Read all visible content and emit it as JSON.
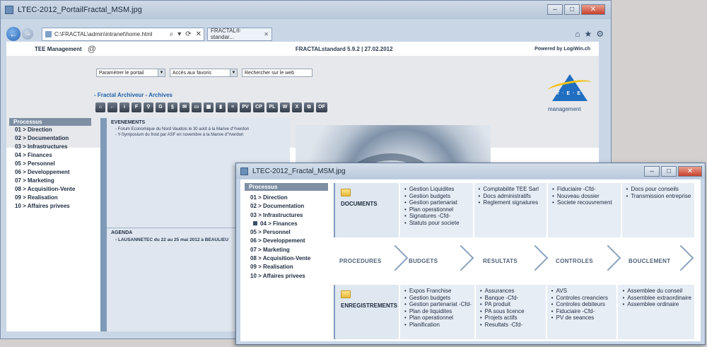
{
  "back_window": {
    "title": "LTEC-2012_PortailFractal_MSM.jpg",
    "controls": [
      "–",
      "□",
      "✕"
    ],
    "browser": {
      "url": "C:\\FRACTAL\\admin\\intranet\\home.html",
      "url_icons": [
        "⌕",
        "▾",
        "⟳",
        "✕"
      ],
      "tab_label": "FRACTAL® standar...",
      "tab_close": "✕",
      "toolbar_icons": [
        "⌂",
        "★",
        "⚙"
      ]
    },
    "header": {
      "brand": "TEE Management",
      "at_icon": "@",
      "version": "FRACTALstandard 5.9.2 | 27.02.2012",
      "powered_by": "Powered by LogiWin.ch"
    },
    "selects": [
      {
        "label": "Paramétrer le portail"
      },
      {
        "label": "Accès aux favoris"
      },
      {
        "label": "Rechercher sur le web"
      }
    ],
    "breadcrumb": "- Fractal Archiveur - Archives",
    "toolbar": [
      "⌂",
      "←",
      "i",
      "F",
      "⚲",
      "G",
      "§",
      "✉",
      "▭",
      "▦",
      "▮",
      "≡",
      "PV",
      "CP",
      "PL",
      "W",
      "X",
      "⧉",
      "OF"
    ],
    "logo": {
      "tee": "T · E · E",
      "text": "management"
    },
    "sidebar": {
      "heading": "Processus",
      "items": [
        "01 > Direction",
        "02 > Documentation",
        "03 > Infrastructures",
        "04 > Finances",
        "05 > Personnel",
        "06 > Developpement",
        "07 > Marketing",
        "08 > Acquisition-Vente",
        "09 > Realisation",
        "10 > Affaires privees"
      ]
    },
    "events": {
      "heading": "EVENEMENTS",
      "items": [
        "- Forum Economique du Nord Vaudois le 30 août à la Marive d'Yverdon",
        "- Y-Symposium du froid par ASF en novembre à la Marive d'Yverdon"
      ]
    },
    "agenda": {
      "heading": "AGENDA",
      "items": [
        "- LAUSANNETEC  du 22 au 25 mai 2012 à BEAULIEU"
      ]
    }
  },
  "front_window": {
    "title": "LTEC-2012_Fractal_MSM.jpg",
    "controls": [
      "–",
      "□",
      "✕"
    ],
    "sidebar": {
      "heading": "Processus",
      "items": [
        "01 > Direction",
        "02 > Documentation",
        "03 > Infrastructures",
        "04 > Finances",
        "05 > Personnel",
        "06 > Developpement",
        "07 > Marketing",
        "08 > Acquisition-Vente",
        "09 > Realisation",
        "10 > Affaires privees"
      ]
    },
    "documents": {
      "label": "DOCUMENTS",
      "cols": [
        [
          "Gestion Liquidites",
          "Gestion budgets",
          "Gestion partenariat",
          "Plan operationnel",
          "Signatures -Cfd-",
          "Statuts pour societe"
        ],
        [
          "Comptabilite TEE Sarl",
          "Docs administratifs",
          "Reglement signatures"
        ],
        [
          "Fiduciaire -Cfd-",
          "Nouveau dossier",
          "Societe recouvrement"
        ],
        [
          "Docs pour conseils",
          "Transmission entreprise"
        ]
      ]
    },
    "process_steps": [
      "PROCEDURES",
      "BUDGETS",
      "RESULTATS",
      "CONTROLES",
      "BOUCLEMENT"
    ],
    "enregistrements": {
      "label": "ENREGISTREMENTS",
      "cols": [
        [
          "Expos Franchise",
          "Gestion budgets",
          "Gestion partenariat -Cfd-",
          "Plan de liquidites",
          "Plan operationnel",
          "Planification"
        ],
        [
          "Assurances",
          "Banque -Cfd-",
          "PA produit",
          "PA sous licence",
          "Projets actifs",
          "Resultats -Cfd-"
        ],
        [
          "AVS",
          "Controles creanciers",
          "Controles debiteurs",
          "Fiduciaire -Cfd-",
          "PV de seances"
        ],
        [
          "Assemblee du conseil",
          "Assemblee extraordinaire",
          "Assemblee ordinaire"
        ]
      ]
    }
  }
}
